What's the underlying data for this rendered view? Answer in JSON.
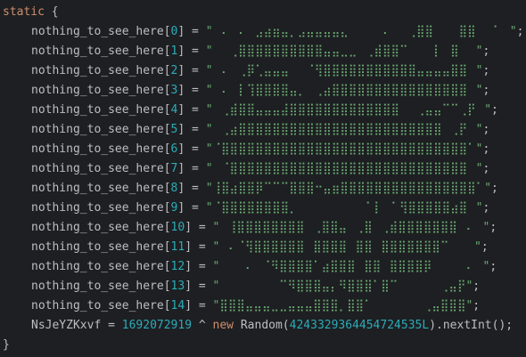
{
  "code": {
    "header_keyword": "static",
    "open_brace": " {",
    "close_brace": "}",
    "array_name": "nothing_to_see_here",
    "rows": [
      {
        "index": "0",
        "value": "\"⠀⠄⠀⠄⠀⣠⣴⣶⣤⡀⣠⣤⣤⣤⣤⣄⠀⠀⠀⠀⠄⠀⠀⢀⣿⣿⠀⠀⠀⣿⣿⠀⠀⠁⠀\""
      },
      {
        "index": "1",
        "value": "\"⠀⠀⢀⣿⣿⣿⣿⣿⣿⣿⣿⣿⣿⣤⣤⣀⣀⠀⢀⣾⣿⣿⠉⠀⠀⠀⡇⠀⣿⠀⠀\""
      },
      {
        "index": "2",
        "value": "\"⠀⠄⠀⢀⡿⢁⣤⣤⣤⠀⠀⠈⢻⣿⣿⣿⣿⣿⣿⣿⣿⣿⣿⣿⣤⣤⣤⣤⣿⣿⠀\""
      },
      {
        "index": "3",
        "value": "\"⠀⠄⠀⡇⢹⣿⣿⣿⣿⣤⡀⠀⢀⣴⣿⣿⣿⣿⣿⣿⣿⣿⣿⣿⣿⣿⣿⣿⣿⣿⠀\""
      },
      {
        "index": "4",
        "value": "\"⠀⢀⣾⣿⣿⣤⣤⣤⣼⣿⣿⣿⣿⣿⣿⣿⣿⣿⣿⣿⣿⣿⠀⠀⢀⣤⣤⠉⠉⢀⡟⠀\""
      },
      {
        "index": "5",
        "value": "\"⠀⢀⣴⣿⣿⣿⣿⣿⣿⣿⣿⣿⣿⣿⣿⣿⣿⣿⣿⣿⣿⣿⣿⣿⣿⣿⣿⠀⢀⡟⠀\""
      },
      {
        "index": "6",
        "value": "\"⠈⣿⣿⣿⣿⣿⣿⣿⣿⣿⣿⣿⣿⣿⣿⣿⣿⣿⣿⣿⣿⣿⣿⣿⣿⣿⣿⣿⣿⣿⠁\""
      },
      {
        "index": "7",
        "value": "\"⠀⠈⣿⣿⣿⣿⣿⣿⣿⣿⣿⣿⣿⣿⣿⣿⣿⣿⣿⣿⣿⣿⣿⣿⣿⣿⣿⣿⣿⣿⠀\""
      },
      {
        "index": "8",
        "value": "\"⢸⣿⣴⣿⣿⡿⠉⠉⠉⣿⣿⣿⠒⣤⣶⣿⣿⣿⣿⣿⣿⣿⣿⣿⣿⣿⣿⣿⣿⣿⣿⠁\""
      },
      {
        "index": "9",
        "value": "\"⠈⣿⣿⣿⣿⣿⣿⣿⣿⡀⠀⠀⠀⠀⠀⠀⠀⠀⠁⡇⠀⠁⢻⣿⣿⣿⣿⣿⣴⣿⠀\""
      },
      {
        "index": "10",
        "value": "\"⠀⢸⣿⣿⣿⣿⣿⣿⣿⣿⠀⢀⣿⣿⣤⠀⢀⣿⠀⢀⣾⣿⣿⣿⣿⣿⣿⣿⠀⠄⠀\""
      },
      {
        "index": "11",
        "value": "\"⠀⠄⠈⢻⣿⣿⣿⣿⣿⣿⠀⣿⣿⣿⣿⠀⣿⣿⠀⣿⣿⣿⣿⣿⣿⣿⠉⠀⠀⠀\""
      },
      {
        "index": "12",
        "value": "\"⠀⠀⠀⠄⠀⠈⠻⣿⣿⣿⣿⠁⣴⣿⣿⣿⠀⣿⣿⠀⣿⣿⣿⣿⡿⠀⠀⠀⠀⠄⠀\""
      },
      {
        "index": "13",
        "value": "\"⠀⠀⠀⠀⠀⠀⠀⠉⠻⣿⣿⣿⣤⡄⠻⣿⣿⣿⠁⣿⠉⠀⠀⠀⠀⠀⢀⣤⡟\""
      },
      {
        "index": "14",
        "value": "\"⣿⣿⣿⣤⣤⣤⣀⣀⣤⣤⣤⣿⣿⣿⡀⣿⣿⠁⠀⠀⠀⠀⠀⠀⢀⣤⣿⣿⣿\""
      }
    ],
    "last_line": {
      "var_name": "NsJeYZKxvf",
      "eq": " = ",
      "num1": "1692072919",
      "op": " ^ ",
      "kw_new": "new",
      "class_name": " Random(",
      "num2": "4243329364454724535L",
      "tail": ").nextInt();"
    }
  }
}
